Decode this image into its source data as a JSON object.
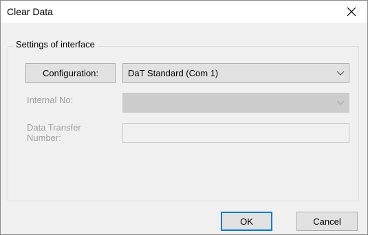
{
  "window": {
    "title": "Clear Data"
  },
  "groupbox": {
    "legend": "Settings of interface"
  },
  "configuration": {
    "button_label": "Configuration:",
    "selected_value": "DaT Standard (Com 1)"
  },
  "internal_no": {
    "label": "Internal No:",
    "selected_value": ""
  },
  "data_transfer": {
    "label_line1": "Data Transfer",
    "label_line2": "Number:",
    "value": ""
  },
  "buttons": {
    "ok_label": "OK",
    "cancel_label": "Cancel"
  },
  "icons": {
    "close": "close-icon",
    "dropdown": "chevron-down-icon"
  },
  "colors": {
    "accent": "#0078d7",
    "disabled_text": "#a0a0a0",
    "dialog_bg": "#f0f0f0"
  }
}
